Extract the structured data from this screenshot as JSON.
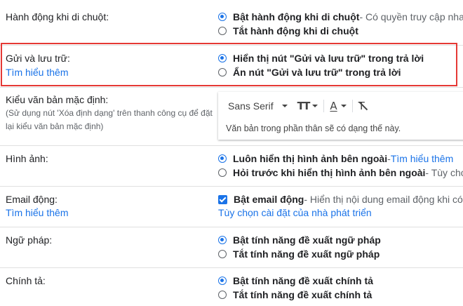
{
  "hover": {
    "label": "Hành động khi di chuột:",
    "options": [
      {
        "title": "Bật hành động khi di chuột",
        "desc": " - Có quyền truy cập nhanh",
        "selected": true
      },
      {
        "title": "Tắt hành động khi di chuột",
        "desc": "",
        "selected": false
      }
    ]
  },
  "send_archive": {
    "label": "Gửi và lưu trữ:",
    "link": "Tìm hiểu thêm",
    "options": [
      {
        "title": "Hiển thị nút \"Gửi và lưu trữ\" trong trả lời",
        "selected": true
      },
      {
        "title": "Ẩn nút \"Gửi và lưu trữ\" trong trả lời",
        "selected": false
      }
    ]
  },
  "default_text": {
    "label": "Kiểu văn bản mặc định:",
    "hint_line1": "(Sử dụng nút 'Xóa định dạng' trên thanh công cụ để đặt",
    "hint_line2": "lại kiểu văn bản mặc định)",
    "font": "Sans Serif",
    "sample": "Văn bản trong phần thân sẽ có dạng thế này.",
    "icons": [
      "text-size-icon",
      "text-color-icon",
      "clear-format-icon"
    ]
  },
  "images": {
    "label": "Hình ảnh:",
    "options": [
      {
        "title": "Luôn hiển thị hình ảnh bên ngoài",
        "desc": " - ",
        "link": "Tìm hiểu thêm",
        "selected": true
      },
      {
        "title": "Hỏi trước khi hiển thị hình ảnh bên ngoài",
        "desc": " - Tùy chọn nà",
        "selected": false
      }
    ]
  },
  "dynamic_email": {
    "label": "Email động:",
    "link": "Tìm hiểu thêm",
    "checkbox": {
      "title": "Bật email động",
      "desc": " - Hiển thị nội dung email động khi có s",
      "checked": true
    },
    "dev_link": "Tùy chọn cài đặt của nhà phát triển"
  },
  "grammar": {
    "label": "Ngữ pháp:",
    "options": [
      {
        "title": "Bật tính năng đề xuất ngữ pháp",
        "selected": true
      },
      {
        "title": "Tắt tính năng đề xuất ngữ pháp",
        "selected": false
      }
    ]
  },
  "spelling": {
    "label": "Chính tả:",
    "options": [
      {
        "title": "Bật tính năng đề xuất chính tả",
        "selected": true
      },
      {
        "title": "Tắt tính năng đề xuất chính tả",
        "selected": false
      }
    ]
  },
  "colors": {
    "accent": "#1a73e8",
    "highlight_border": "#e53935"
  }
}
